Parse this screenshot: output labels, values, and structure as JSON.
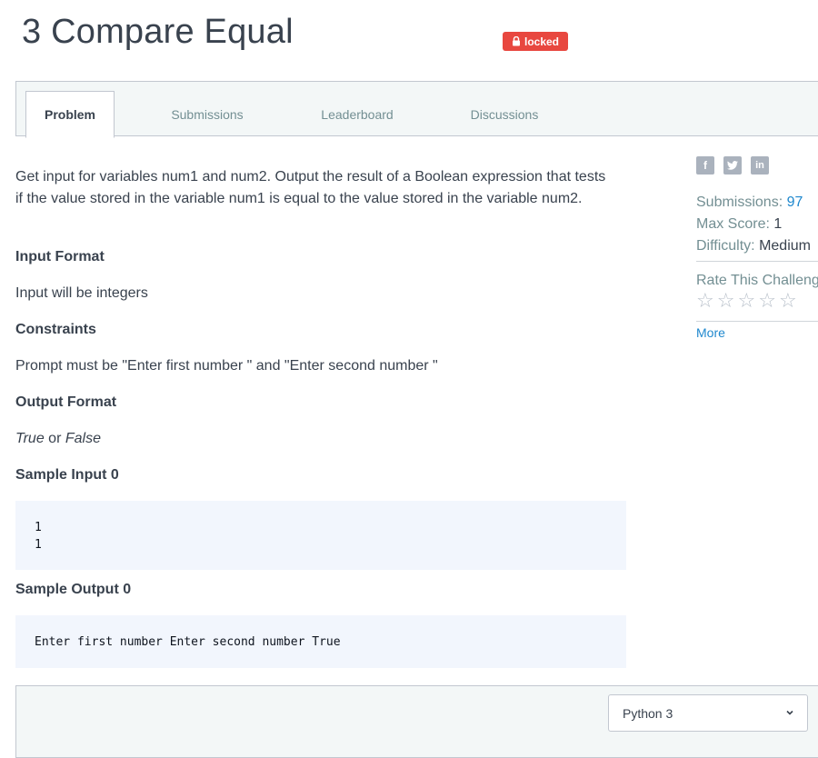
{
  "header": {
    "title": "3 Compare Equal",
    "badge": "locked"
  },
  "tabs": [
    {
      "label": "Problem",
      "active": true
    },
    {
      "label": "Submissions",
      "active": false
    },
    {
      "label": "Leaderboard",
      "active": false
    },
    {
      "label": "Discussions",
      "active": false
    }
  ],
  "problem": {
    "description": "Get input for variables num1 and num2. Output the result of a Boolean expression that tests if the value stored in the variable num1 is equal to the value stored in the variable num2.",
    "input_format_heading": "Input Format",
    "input_format_text": "Input will be integers",
    "constraints_heading": "Constraints",
    "constraints_text": "Prompt must be \"Enter first number \" and \"Enter second number \"",
    "output_format_heading": "Output Format",
    "output_true": "True",
    "output_or": " or ",
    "output_false": "False",
    "sample_input_heading": "Sample Input 0",
    "sample_input_lines": [
      "1",
      "1"
    ],
    "sample_output_heading": "Sample Output 0",
    "sample_output_text": "Enter first number Enter second number True"
  },
  "sidebar": {
    "social_icons": [
      "facebook-icon",
      "twitter-icon",
      "linkedin-icon"
    ],
    "submissions_label": "Submissions: ",
    "submissions_value": "97",
    "max_score_label": "Max Score: ",
    "max_score_value": "1",
    "difficulty_label": "Difficulty: ",
    "difficulty_value": "Medium",
    "rate_label": "Rate This Challenge:",
    "rating_stars": 0,
    "rating_max": 5,
    "more_label": "More"
  },
  "editor": {
    "language": "Python 3"
  },
  "colors": {
    "badge_red": "#e8473f",
    "link_blue": "#1f88ce",
    "text_dark": "#39424e",
    "muted": "#738f93",
    "code_bg": "#f2f6fd"
  }
}
